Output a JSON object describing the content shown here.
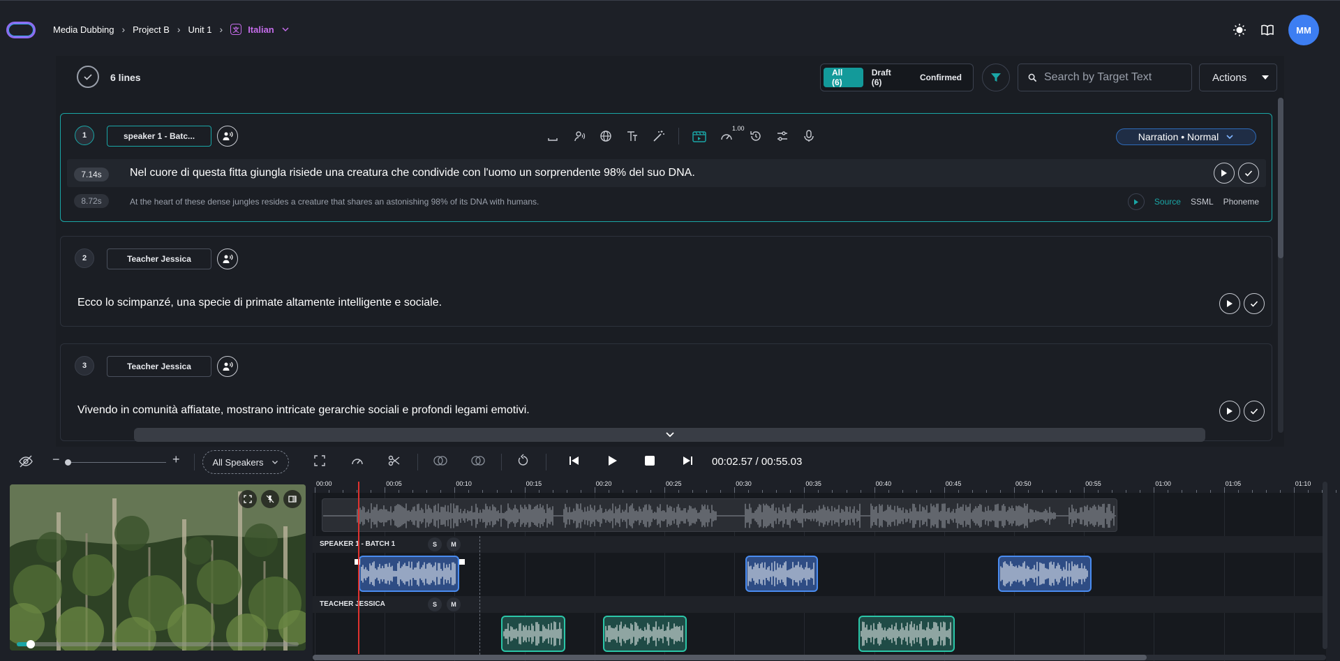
{
  "breadcrumb": {
    "items": [
      "Media Dubbing",
      "Project B",
      "Unit 1"
    ],
    "language": "Italian"
  },
  "user": {
    "initials": "MM"
  },
  "header": {
    "lines_count": "6 lines",
    "filters": {
      "all": "All (6)",
      "draft": "Draft (6)",
      "confirmed": "Confirmed"
    },
    "search_placeholder": "Search by Target Text",
    "actions_label": "Actions"
  },
  "lines": [
    {
      "number": "1",
      "speaker": "speaker 1 - Batc...",
      "mode": "Narration • Normal",
      "speed_badge": "1.00",
      "target_duration": "7.14s",
      "target_text": "Nel cuore di questa fitta giungla risiede una creatura che condivide con l'uomo un sorprendente 98% del suo DNA.",
      "source_duration": "8.72s",
      "source_text": "At the heart of these dense jungles resides a creature that shares an astonishing 98% of its DNA with humans.",
      "source_tabs": [
        "Source",
        "SSML",
        "Phoneme"
      ]
    },
    {
      "number": "2",
      "speaker": "Teacher Jessica",
      "target_text": "Ecco lo scimpanzé, una specie di primate altamente intelligente e sociale."
    },
    {
      "number": "3",
      "speaker": "Teacher Jessica",
      "target_text": "Vivendo in comunità affiatate, mostrano intricate gerarchie sociali e profondi legami emotivi."
    }
  ],
  "timeline_controls": {
    "speaker_filter": "All Speakers",
    "time_display": "00:02.57 / 00:55.03"
  },
  "ruler_ticks": [
    "00:00",
    "00:05",
    "00:10",
    "00:15",
    "00:20",
    "00:25",
    "00:30",
    "00:35",
    "00:40",
    "00:45",
    "00:50",
    "00:55",
    "01:00",
    "01:05",
    "01:10"
  ],
  "tracks": [
    {
      "name": "SPEAKER 1 - BATCH 1",
      "solo": "S",
      "mute": "M"
    },
    {
      "name": "TEACHER JESSICA",
      "solo": "S",
      "mute": "M"
    }
  ],
  "video": {
    "progress_fraction": 0.05
  },
  "colors": {
    "accent": "#1aa6a6",
    "language": "#c46ce9",
    "clip_blue": "#4a8cf0",
    "clip_green": "#2bc6a8",
    "playhead": "#e0322f"
  }
}
